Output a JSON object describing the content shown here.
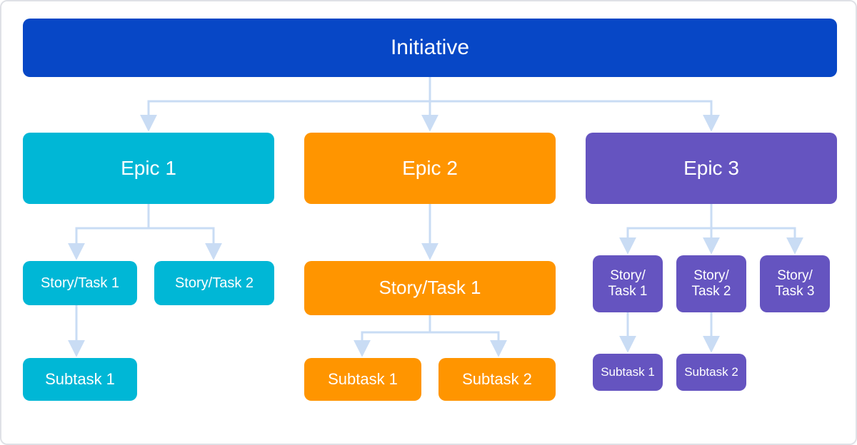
{
  "colors": {
    "initiative": "#0747c6",
    "epic1": "#00b7d6",
    "epic2": "#ff9500",
    "epic3": "#6554c0",
    "connector": "#c9dcf4",
    "border": "#dfe1e6"
  },
  "hierarchy": {
    "initiative": {
      "label": "Initiative",
      "epics": [
        {
          "id": "epic1",
          "label": "Epic 1",
          "color": "cyan",
          "stories": [
            {
              "label": "Story/Task 1",
              "subtasks": [
                {
                  "label": "Subtask 1"
                }
              ]
            },
            {
              "label": "Story/Task 2",
              "subtasks": []
            }
          ]
        },
        {
          "id": "epic2",
          "label": "Epic 2",
          "color": "orange",
          "stories": [
            {
              "label": "Story/Task 1",
              "subtasks": [
                {
                  "label": "Subtask 1"
                },
                {
                  "label": "Subtask 2"
                }
              ]
            }
          ]
        },
        {
          "id": "epic3",
          "label": "Epic 3",
          "color": "purple",
          "stories": [
            {
              "label": "Story/ Task 1",
              "subtasks": [
                {
                  "label": "Subtask 1"
                }
              ]
            },
            {
              "label": "Story/ Task 2",
              "subtasks": [
                {
                  "label": "Subtask 2"
                }
              ]
            },
            {
              "label": "Story/ Task 3",
              "subtasks": []
            }
          ]
        }
      ]
    }
  }
}
